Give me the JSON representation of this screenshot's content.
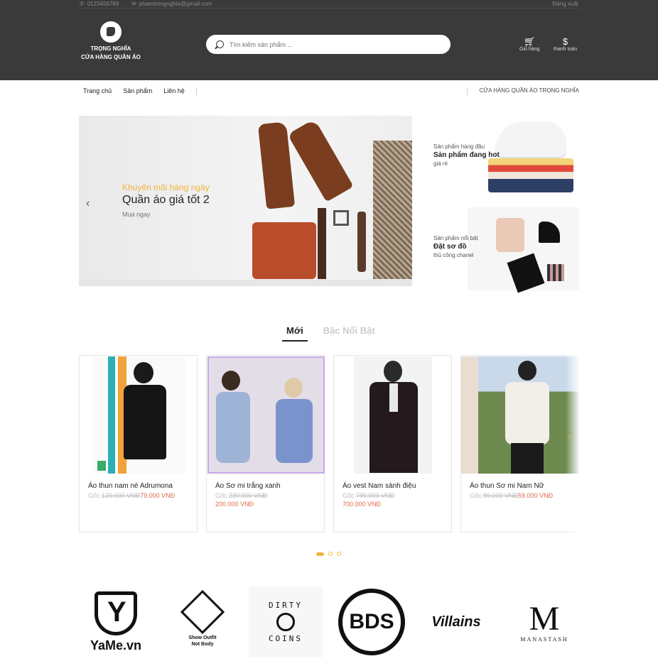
{
  "topbar": {
    "phone": "0123456789",
    "email": "phamtrongnghia@gmail.com",
    "login": "Đăng xuất"
  },
  "logo": {
    "name": "TRỌNG NGHĨA",
    "subtitle": "CỬA HÀNG QUẦN ÁO"
  },
  "search": {
    "placeholder": "Tìm kiếm sản phẩm ..."
  },
  "header_actions": {
    "cart": "Giỏ hàng",
    "checkout": "thanh toán"
  },
  "nav": {
    "items": [
      "Trang chủ",
      "Sản phẩm",
      "Liên hệ"
    ],
    "right_label": "CỬA HÀNG QUẦN ÁO TRỌNG NGHĨA"
  },
  "hero": {
    "small": "Khuyến mãi hàng ngày",
    "title": "Quần áo giá tốt 2",
    "button": "Mua ngay"
  },
  "side_banners": [
    {
      "label": "Sản phẩm hàng đầu",
      "title": "Sản phẩm đang hot",
      "sub": "giá rẻ"
    },
    {
      "label": "Sản phẩm nổi bật",
      "title": "Đặt sơ đồ",
      "sub": "thủ công chanel"
    }
  ],
  "tabs": [
    "Mới",
    "Bậc Nổi Bật"
  ],
  "products": [
    {
      "name": "Áo thun nam nè Adrumona",
      "orig_label": "Gốc:",
      "orig": "120.000 VNĐ",
      "sale": "79.000 VNĐ"
    },
    {
      "name": "Áo Sơ mi trắng xanh",
      "orig_label": "Gốc:",
      "orig": "230.000 VNĐ",
      "sale": "200.000 VNĐ"
    },
    {
      "name": "Áo vest Nam sành điệu",
      "orig_label": "Gốc:",
      "orig": "790.000 VNĐ",
      "sale": "700.000 VNĐ"
    },
    {
      "name": "Áo thun Sơ mi Nam Nữ",
      "orig_label": "Gốc:",
      "orig": "89.000 VNĐ",
      "sale": "59.000 VNĐ"
    }
  ],
  "brands": {
    "yame": "YaMe.vn",
    "soa_1": "Show Outfit",
    "soa_2": "Not Body",
    "dirty_1": "DIRTY",
    "dirty_2": "COINS",
    "bds": "BDS",
    "villains": "Villains",
    "mana_m": "M",
    "mana_t": "MANASTASH"
  },
  "colors": {
    "header_bg": "#3a3a3a",
    "accent": "#f2b43c",
    "sale": "#e06a4e"
  }
}
